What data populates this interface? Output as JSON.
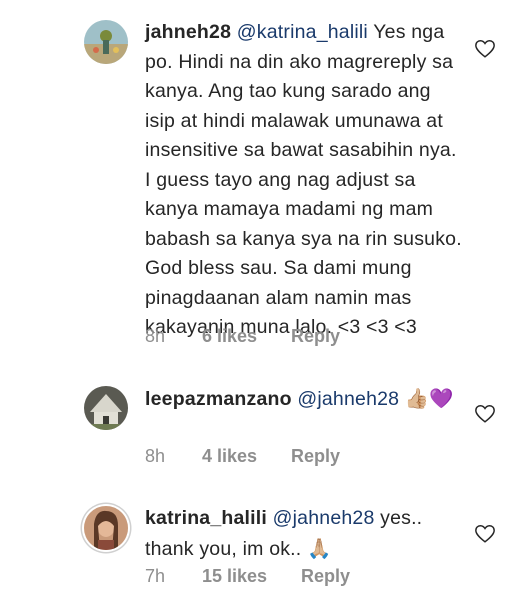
{
  "comments": [
    {
      "username": "jahneh28",
      "mention": "@katrina_halili",
      "text": " Yes nga po. Hindi na din ako magrereply sa kanya. Ang tao kung sarado ang isip at hindi malawak umunawa at insensitive sa bawat sasabihin nya. I guess tayo ang nag adjust sa kanya mamaya madami ng mam babash sa kanya sya na rin susuko. God bless sau. Sa dami mung pinagdaanan alam namin mas kakayanin muna lalo. <3 <3 <3",
      "time": "8h",
      "likes": "6 likes",
      "reply": "Reply"
    },
    {
      "username": "leepazmanzano",
      "mention": "@jahneh28",
      "emoji": "👍🏼💜",
      "time": "8h",
      "likes": "4 likes",
      "reply": "Reply"
    },
    {
      "username": "katrina_halili",
      "mention": "@jahneh28",
      "text": " yes.. thank you, im ok..",
      "emoji": "🙏🏼",
      "time": "7h",
      "likes": "15 likes",
      "reply": "Reply"
    }
  ],
  "icons": {
    "like": "heart-outline-icon"
  },
  "colors": {
    "mention": "#1a3a6b",
    "meta": "#8e8e8e",
    "text": "#262626"
  }
}
